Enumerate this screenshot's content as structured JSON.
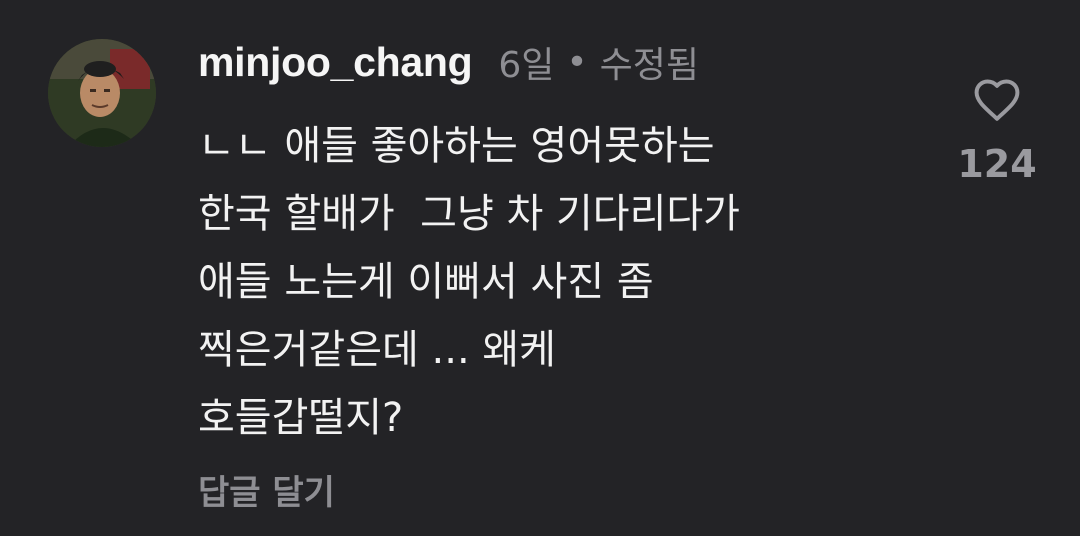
{
  "comment": {
    "username": "minjoo_chang",
    "time": "6일",
    "separator": "•",
    "edited": "수정됨",
    "body": "ㄴㄴ 애들 좋아하는 영어못하는\n한국 할배가  그냥 차 기다리다가\n애들 노는게 이뻐서 사진 좀\n찍은거같은데 ... 왜케\n호들갑떨지?",
    "reply_label": "답글 달기",
    "like_count": "124"
  },
  "icons": {
    "avatar": "profile-photo",
    "like": "heart-outline-icon"
  },
  "colors": {
    "background": "#232326",
    "primary_text": "#f2f2f2",
    "secondary_text": "#8e8e93"
  }
}
